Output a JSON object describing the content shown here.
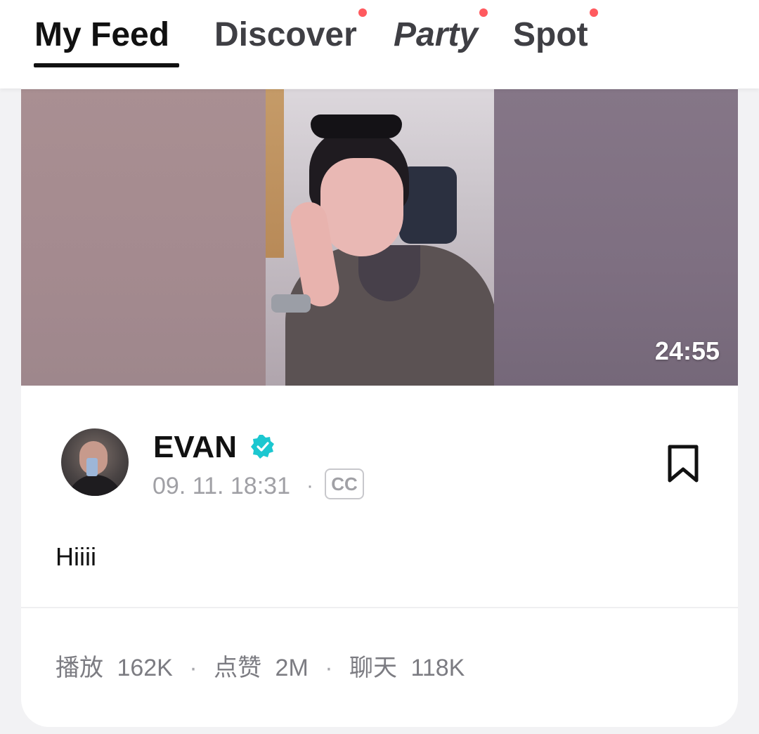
{
  "tabs": [
    {
      "label": "My Feed",
      "active": true,
      "new_dot": false
    },
    {
      "label": "Discover",
      "active": false,
      "new_dot": true
    },
    {
      "label": "Party",
      "active": false,
      "new_dot": true
    },
    {
      "label": "Spot",
      "active": false,
      "new_dot": true
    }
  ],
  "post": {
    "video": {
      "duration": "24:55"
    },
    "author": {
      "name": "EVAN",
      "verified": true,
      "verified_icon": "verified-badge-icon",
      "avatar_icon": "avatar"
    },
    "timestamp": "09. 11. 18:31",
    "meta_separator": "·",
    "cc_label": "CC",
    "bookmark_icon": "bookmark-icon",
    "text": "Hiiii",
    "stats": {
      "plays_label": "播放",
      "plays_value": "162K",
      "likes_label": "点赞",
      "likes_value": "2M",
      "chats_label": "聊天",
      "chats_value": "118K",
      "separator": "·"
    }
  },
  "colors": {
    "accent_dot": "#ff5a5f",
    "verified": "#1cc7d0",
    "text_primary": "#111111",
    "text_secondary": "#a0a0a5"
  }
}
